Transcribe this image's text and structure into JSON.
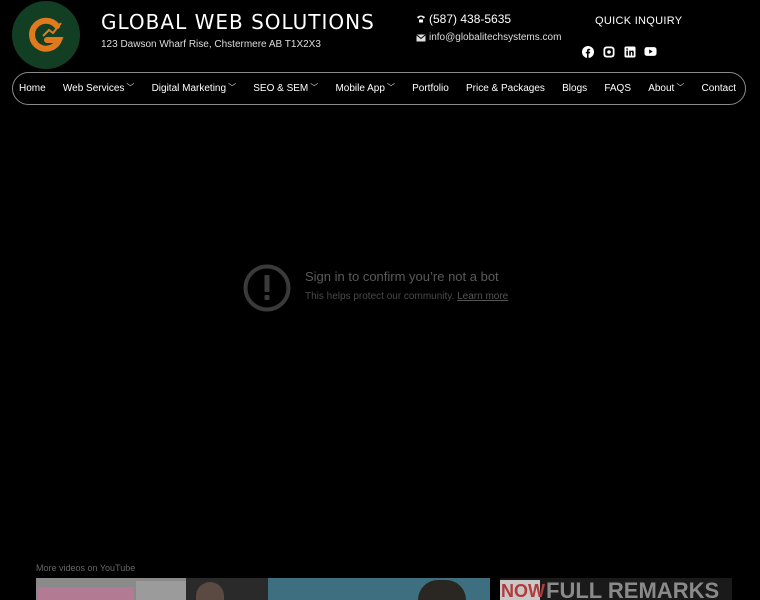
{
  "header": {
    "logo_letter": "G",
    "title": "GLOBAL WEB SOLUTIONS",
    "address": "123 Dawson Wharf Rise, Chstermere AB T1X2X3",
    "phone": "(587) 438-5635",
    "email": "info@globalitechsystems.com",
    "quick_inquiry": "QUICK INQUIRY",
    "socials": [
      {
        "icon": "facebook-icon"
      },
      {
        "icon": "instagram-icon"
      },
      {
        "icon": "linkedin-icon"
      },
      {
        "icon": "youtube-icon"
      }
    ]
  },
  "nav": {
    "items": [
      {
        "label": "Home",
        "dropdown": false
      },
      {
        "label": "Web Services",
        "dropdown": true
      },
      {
        "label": "Digital Marketing",
        "dropdown": true
      },
      {
        "label": "SEO & SEM",
        "dropdown": true
      },
      {
        "label": "Mobile App",
        "dropdown": true
      },
      {
        "label": "Portfolio",
        "dropdown": false
      },
      {
        "label": "Price & Packages",
        "dropdown": false
      },
      {
        "label": "Blogs",
        "dropdown": false
      },
      {
        "label": "FAQS",
        "dropdown": false
      },
      {
        "label": "About",
        "dropdown": true
      },
      {
        "label": "Contact",
        "dropdown": false
      }
    ]
  },
  "video": {
    "title": "Sign in to confirm you’re not a bot",
    "subtitle": "This helps protect our community.",
    "link": "Learn more",
    "more_videos": "More videos on YouTube",
    "thumb_text": "NOW",
    "thumb_text_2": "FULL REMARKS"
  },
  "colors": {
    "logo_bg": "#123f24",
    "logo_mark": "#e07a1c",
    "nav_border": "#8a8a8a"
  }
}
